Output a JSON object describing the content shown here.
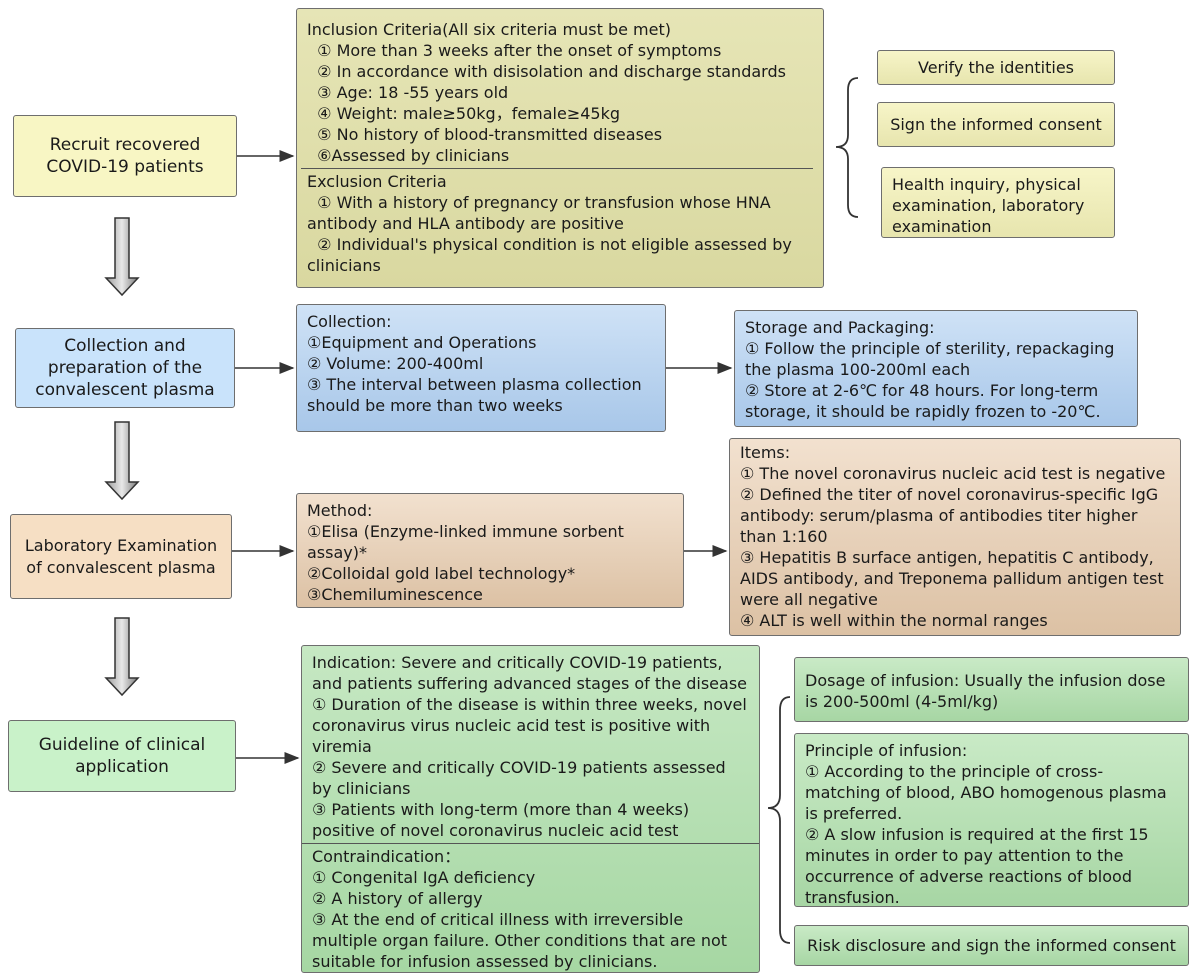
{
  "stages": [
    {
      "id": "recruit",
      "label": "Recruit recovered\nCOVID-19 patients"
    },
    {
      "id": "collection",
      "label": "Collection and\npreparation of the\nconvalescent plasma"
    },
    {
      "id": "lab",
      "label": "Laboratory Examination\nof convalescent plasma"
    },
    {
      "id": "guideline",
      "label": "Guideline of clinical\napplication"
    }
  ],
  "criteria": {
    "inclusion_title": "Inclusion Criteria(All six criteria must be met)",
    "inclusion": [
      "  ① More than 3 weeks after the onset of symptoms",
      "  ② In accordance with disisolation and discharge standards",
      "  ③ Age: 18 -55 years old",
      "  ④ Weight: male≥50kg，female≥45kg",
      "  ⑤ No history of blood-transmitted diseases",
      "  ⑥Assessed by clinicians"
    ],
    "exclusion_title": "Exclusion Criteria",
    "exclusion": [
      "  ① With a history of pregnancy or transfusion whose HNA antibody and HLA antibody are positive",
      "  ② Individual's physical condition is not eligible assessed by clinicians"
    ]
  },
  "recruit_steps": [
    "Verify the identities",
    "Sign the informed consent",
    "Health inquiry, physical examination, laboratory examination"
  ],
  "collection": {
    "title": "Collection:",
    "items": [
      "①Equipment and Operations",
      "② Volume: 200-400ml",
      "③ The interval between plasma collection should be more than two weeks"
    ]
  },
  "storage": {
    "title": "Storage and Packaging:",
    "items": [
      "① Follow the principle of sterility, repackaging the plasma 100-200ml each",
      "② Store at 2-6℃ for 48 hours. For long-term storage, it should be rapidly frozen to -20℃."
    ]
  },
  "method": {
    "title": "Method:",
    "items": [
      "①Elisa (Enzyme-linked immune sorbent assay)*",
      "②Colloidal gold label technology*",
      "③Chemiluminescence"
    ]
  },
  "lab_items": {
    "title": "Items:",
    "items": [
      "① The novel coronavirus nucleic acid test is negative",
      "② Defined the titer of novel coronavirus-specific IgG antibody: serum/plasma of antibodies titer higher than 1:160",
      "③ Hepatitis B surface antigen, hepatitis C antibody, AIDS antibody, and Treponema pallidum antigen test were all negative",
      "④ ALT is well within the normal ranges"
    ]
  },
  "indication": {
    "title": "Indication: Severe and critically COVID-19 patients, and patients suffering advanced stages of the disease",
    "items": [
      "① Duration of the disease is within three weeks, novel coronavirus virus nucleic acid test is positive with viremia",
      "② Severe and critically COVID-19 patients assessed by clinicians",
      "③ Patients with long-term (more than 4 weeks) positive of novel coronavirus nucleic acid test"
    ],
    "contra_title": "Contraindication：",
    "contra": [
      "①  Congenital IgA deficiency",
      "②  A history of allergy",
      "③  At the end of critical illness with irreversible multiple organ failure. Other conditions that are not suitable for infusion assessed by clinicians."
    ]
  },
  "infusion": {
    "dosage": "Dosage of infusion:  Usually the infusion dose is 200-500ml (4-5ml/kg)",
    "principle_title": "Principle of infusion:",
    "principle": [
      "①  According to the principle of cross-matching of blood, ABO homogenous plasma is preferred.",
      "② A slow infusion is required at the first 15 minutes in order to pay attention to the occurrence of adverse reactions of blood transfusion."
    ],
    "risk": "Risk disclosure and sign the informed consent"
  }
}
